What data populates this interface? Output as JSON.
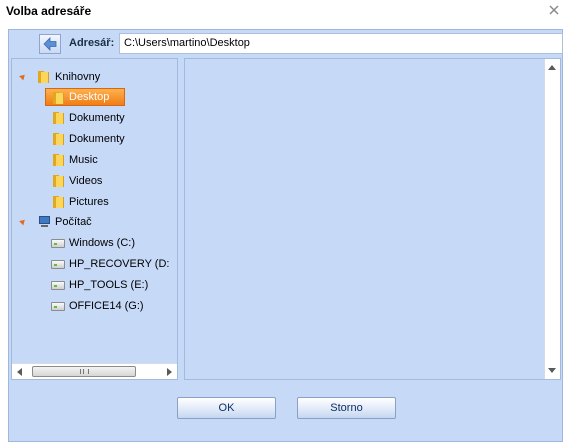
{
  "window": {
    "title": "Volba adresáře"
  },
  "address": {
    "label": "Adresář:",
    "value": "C:\\Users\\martino\\Desktop"
  },
  "tree": {
    "libraries": {
      "label": "Knihovny",
      "items": [
        {
          "label": "Desktop",
          "selected": true
        },
        {
          "label": "Dokumenty"
        },
        {
          "label": "Dokumenty"
        },
        {
          "label": "Music"
        },
        {
          "label": "Videos"
        },
        {
          "label": "Pictures"
        }
      ]
    },
    "computer": {
      "label": "Počítač",
      "drives": [
        {
          "label": "Windows (C:)"
        },
        {
          "label": "HP_RECOVERY (D:"
        },
        {
          "label": "HP_TOOLS (E:)"
        },
        {
          "label": "OFFICE14 (G:)"
        }
      ]
    }
  },
  "buttons": {
    "ok": "OK",
    "cancel": "Storno"
  },
  "colors": {
    "panel": "#c6d9f7",
    "selection": "#f07d16",
    "expander": "#e56a1e"
  },
  "icons": {
    "close": "close-icon",
    "back": "back-arrow-icon",
    "folder": "folder-icon",
    "computer": "computer-icon",
    "drive": "drive-icon"
  }
}
